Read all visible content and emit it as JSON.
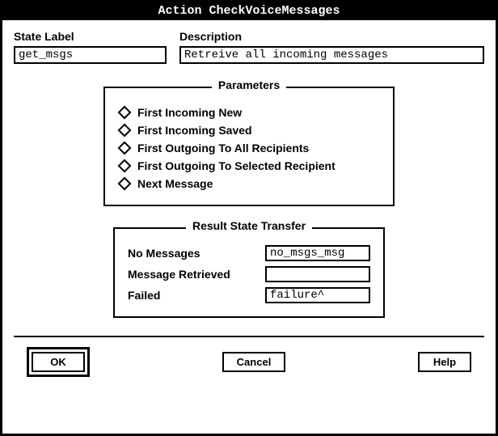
{
  "title": "Action CheckVoiceMessages",
  "fields": {
    "state_label_caption": "State Label",
    "state_label_value": "get_msgs",
    "description_caption": "Description",
    "description_value": "Retreive all incoming messages"
  },
  "parameters": {
    "title": "Parameters",
    "options": [
      "First Incoming New",
      "First Incoming Saved",
      "First Outgoing To All Recipients",
      "First Outgoing To Selected Recipient",
      "Next Message"
    ]
  },
  "result": {
    "title": "Result State Transfer",
    "rows": [
      {
        "label": "No Messages",
        "value": "no_msgs_msg"
      },
      {
        "label": "Message Retrieved",
        "value": ""
      },
      {
        "label": "Failed",
        "value": "failure^"
      }
    ]
  },
  "buttons": {
    "ok": "OK",
    "cancel": "Cancel",
    "help": "Help"
  }
}
